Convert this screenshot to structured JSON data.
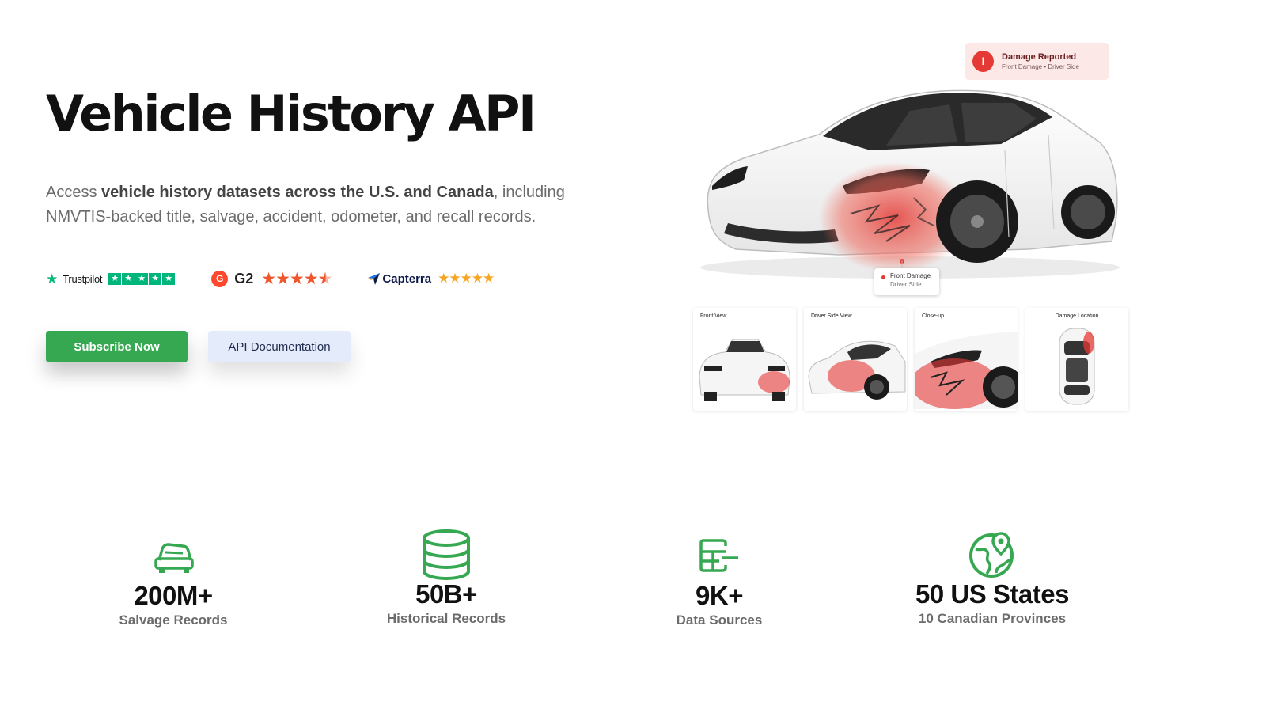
{
  "hero": {
    "title": "Vehicle History API",
    "lede_prefix": "Access ",
    "lede_bold": "vehicle history datasets across the U.S. and Canada",
    "lede_suffix": ", including NMVTIS-backed title, salvage, accident, odometer, and recall records."
  },
  "ratings": {
    "trustpilot": {
      "label": "Trustpilot",
      "stars": 5,
      "color": "#00b67a"
    },
    "g2": {
      "label": "G2",
      "stars": 4.5,
      "color": "#f0562c"
    },
    "capterra": {
      "label": "Capterra",
      "stars": 5,
      "color": "#f5a623"
    }
  },
  "buttons": {
    "subscribe": "Subscribe Now",
    "api_docs": "API Documentation"
  },
  "damage_badge": {
    "title": "Damage Reported",
    "subtitle": "Front Damage • Driver Side"
  },
  "callout": {
    "line1": "Front Damage",
    "line2": "Driver Side"
  },
  "thumbnails": [
    {
      "label": "Front View"
    },
    {
      "label": "Driver Side View"
    },
    {
      "label": "Close-up"
    },
    {
      "label": "Damage Location"
    }
  ],
  "stats": [
    {
      "value": "200M+",
      "label": "Salvage Records",
      "icon": "car-crash-icon"
    },
    {
      "value": "50B+",
      "label": "Historical Records",
      "icon": "database-icon"
    },
    {
      "value": "9K+",
      "label": "Data Sources",
      "icon": "data-sources-icon"
    },
    {
      "value": "50 US States",
      "label": "10 Canadian Provinces",
      "icon": "globe-pin-icon"
    }
  ],
  "colors": {
    "accent_green": "#36a851",
    "damage_red": "#e53935",
    "secondary_button": "#e4ecfb"
  }
}
